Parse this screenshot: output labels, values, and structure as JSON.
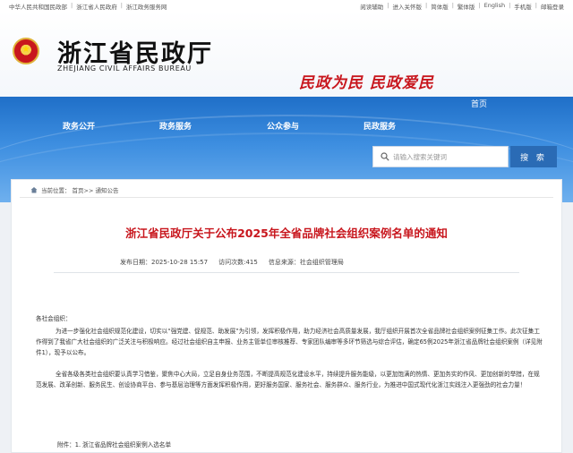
{
  "topbar": {
    "left_links": [
      "中华人民共和国民政部",
      "浙江省人民政府",
      "浙江政务服务网"
    ],
    "right_links": [
      "阅读辅助",
      "进入关怀版",
      "简体版",
      "繁体版",
      "English",
      "手机版",
      "邮箱登录"
    ]
  },
  "header": {
    "title": "浙江省民政厅",
    "subtitle": "ZHEJIANG CIVIL AFFAIRS BUREAU",
    "slogan": "民政为民  民政爱民"
  },
  "nav": {
    "home": "首页",
    "items": [
      "政务公开",
      "政务服务",
      "公众参与",
      "民政服务"
    ]
  },
  "search": {
    "placeholder": "请输入搜索关键词",
    "button": "搜 索"
  },
  "breadcrumb": {
    "current": "当前位置：",
    "path": "首页>> 通知公告"
  },
  "article": {
    "title": "浙江省民政厅关于公布2025年全省品牌社会组织案例名单的通知",
    "published": "发布日期：2025-10-28 15:57",
    "views": "访问次数:415",
    "source": "信息来源：社会组织管理局",
    "salutation": "各社会组织：",
    "para1": "为进一步强化社会组织规范化建设，切实以“强党建、促规范、助发展”为引领，发挥积极作用，助力经济社会高质量发展，我厅组织开展首次全省品牌社会组织案例征集工作。此次征集工作得到了我省广大社会组织的广泛关注与积极响应。经过社会组织自主申报、业务主管单位审核推荐、专家团队编审等多环节筛选与综合评估，确定65例2025年浙江省品牌社会组织案例（详见附件1），现予以公布。",
    "para2": "全省各级各类社会组织要认真学习借鉴，聚焦中心大局，立足自身业务范围，不断提高规范化建设水平，持续提升服务能级，以更加饱满的热情、更加务实的作风、更加创新的举措，在规范发展、改革创新、服务民生、创设协商平台、参与基层治理等方面发挥积极作用，更好服务国家、服务社会、服务群众、服务行业，为推进中国式现代化浙江实践注入更强劲的社会力量！",
    "attachment": "附件：1. 浙江省品牌社会组织案例入选名单"
  },
  "colors": {
    "brand_red": "#c8161d",
    "nav_blue": "#2a6bb5"
  }
}
